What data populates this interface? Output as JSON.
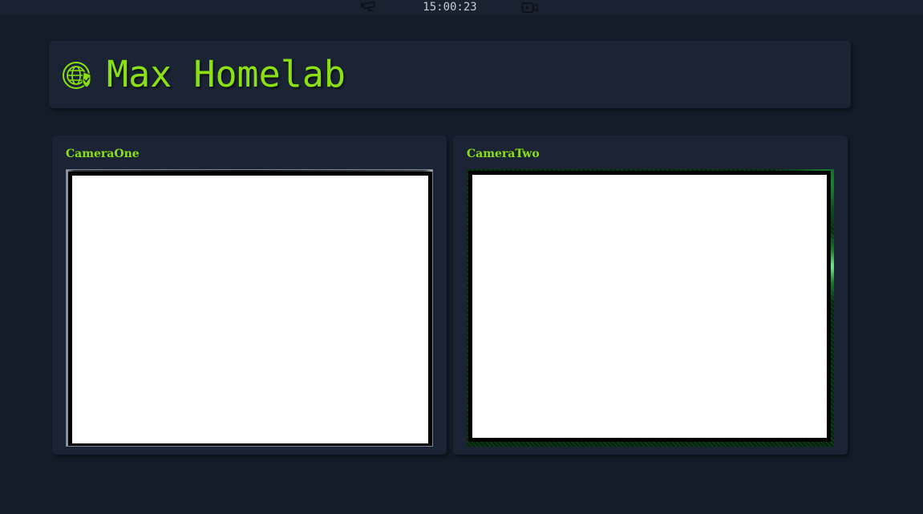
{
  "topbar": {
    "clock": "15:00:23",
    "icons": [
      "security-camera-icon",
      "video-icon"
    ]
  },
  "header": {
    "title": "Max Homelab",
    "logo_icon": "globe-shield-icon"
  },
  "cameras": [
    {
      "label": "CameraOne"
    },
    {
      "label": "CameraTwo"
    }
  ],
  "colors": {
    "accent": "#8be012",
    "background": "#141c29",
    "card": "#1b2435",
    "topbar": "#1a2231"
  }
}
